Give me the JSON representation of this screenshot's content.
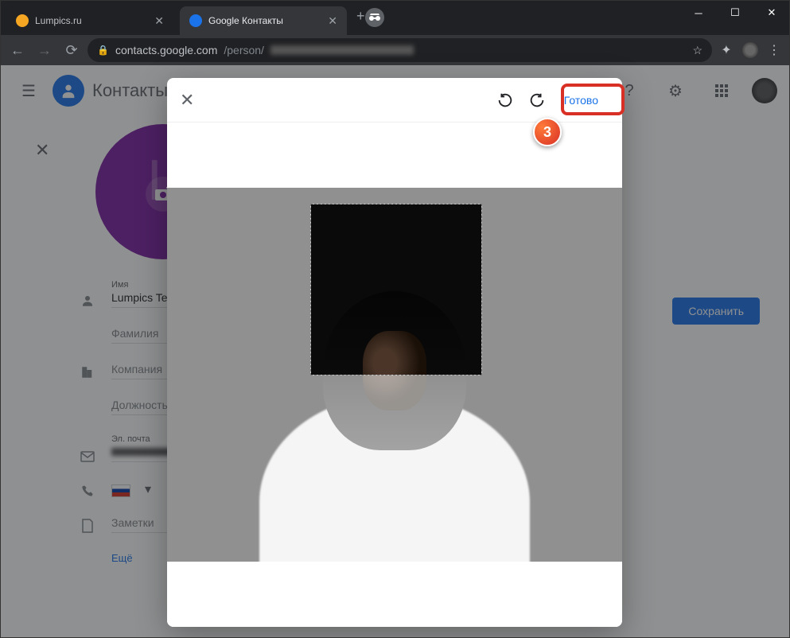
{
  "tabs": [
    {
      "title": "Lumpics.ru",
      "favicon_color": "#f5a623"
    },
    {
      "title": "Google Контакты",
      "favicon_color": "#1a73e8"
    }
  ],
  "url": {
    "domain": "contacts.google.com",
    "path": "/person/"
  },
  "app": {
    "title": "Контакты"
  },
  "contact": {
    "letter": "L",
    "fields": {
      "name_label": "Имя",
      "name_value": "Lumpics Tea",
      "surname_placeholder": "Фамилия",
      "company_placeholder": "Компания",
      "position_placeholder": "Должность",
      "email_label": "Эл. почта",
      "notes_placeholder": "Заметки"
    },
    "save_button": "Сохранить",
    "more_link": "Ещё"
  },
  "modal": {
    "done_button": "Готово"
  },
  "annotation": {
    "step_number": "3"
  }
}
